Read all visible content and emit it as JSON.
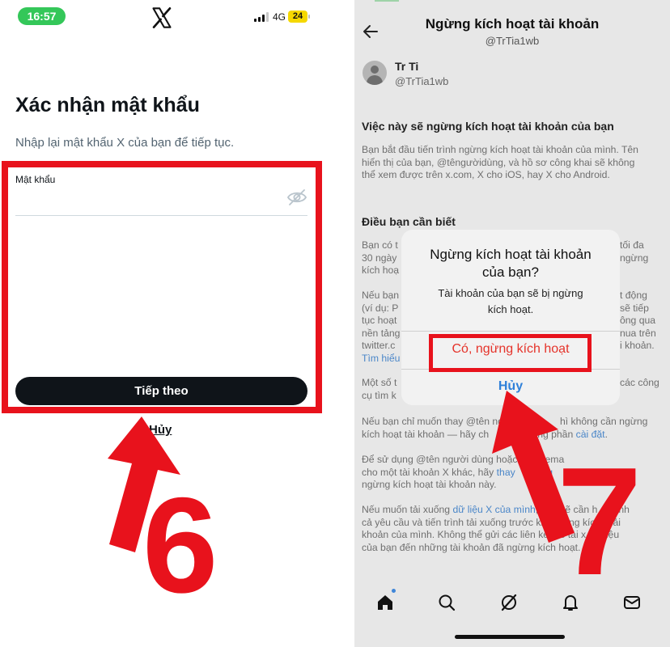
{
  "left": {
    "status": {
      "time": "16:57",
      "network": "4G",
      "battery": "24"
    },
    "title": "Xác nhận mật khẩu",
    "subtitle": "Nhập lại mật khẩu X của bạn để tiếp tục.",
    "password_label": "Mật khẩu",
    "next_button": "Tiếp theo",
    "cancel_link": "Hủy",
    "step_number": "6"
  },
  "right": {
    "title": "Ngừng kích hoạt tài khoản",
    "handle": "@TrTia1wb",
    "user": {
      "name": "Tr Ti",
      "handle": "@TrTia1wb"
    },
    "section1_title": "Việc này sẽ ngừng kích hoạt tài khoản của bạn",
    "section1_lines": [
      "Bạn bắt đầu tiến trình ngừng kích hoạt tài khoản của mình. Tên",
      "hiển thị của bạn, @têngườidùng, và hồ sơ công khai sẽ không",
      "thể xem được trên x.com, X cho iOS, hay X cho Android."
    ],
    "section2_title": "Điều bạn cần biết",
    "section2_p1": [
      "Bạn có t",
      "30 ngày",
      "kích hoạ"
    ],
    "section2_p1_right": [
      "tối đa",
      "ngừng"
    ],
    "section2_p2": [
      "Nếu bạn",
      "(ví dụ: P",
      "tục hoạt",
      "nền tảng",
      "twitter.c"
    ],
    "section2_p2_link": "Tìm hiểu",
    "section2_p2_right": [
      "t động",
      "sẽ tiếp",
      "ông qua",
      "nua trên",
      "i khoản."
    ],
    "section2_p3": [
      "Một số t",
      "cụ tìm k"
    ],
    "section2_p3_right": [
      "các công"
    ],
    "para4_line1": "Nếu bạn chỉ muốn thay @tên ng",
    "para4_line1b": "hì không cần ngừng",
    "para4_line2": "kích hoạt tài khoản — hãy ch",
    "para4_line2b": "ng phần ",
    "para4_link": "cài đặt",
    "para5_line1": "Để sử dụng @tên người dùng hoặc",
    "para5_line1b": "ema",
    "para5_line2": "cho một tài khoản X khác, hãy ",
    "para5_link": "thay",
    "para5_link2": "úng",
    "para5_line3": "ngừng kích hoạt tài khoản này.",
    "para6_line1a": "Nếu muốn tải xuống ",
    "para6_link": "dữ liệu X của mình",
    "para6_line1b": ", bạn sẽ cần h",
    "para6_line1c": "nh",
    "para6_line2": "cả yêu cầu và tiến trình tải xuống trước khi ngừng kíc",
    "para6_line2b": "ải",
    "para6_line3": "khoản của mình. Không thể gửi các liên kết để tải x",
    "para6_line3b": "liệu",
    "para6_line4": "của bạn đến những tài khoản đã ngừng kích hoạt.",
    "dialog": {
      "title_line1": "Ngừng kích hoạt tài khoản",
      "title_line2": "của bạn?",
      "message_line1": "Tài khoản của bạn sẽ bị ngừng",
      "message_line2": "kích hoạt.",
      "confirm": "Có, ngừng kích hoạt",
      "cancel": "Hủy"
    },
    "step_number": "7",
    "nav_icons": [
      "home-icon",
      "search-icon",
      "grok-icon",
      "bell-icon",
      "mail-icon"
    ]
  },
  "colors": {
    "highlight": "#e8121c",
    "status_pill": "#34c759",
    "battery": "#f5d800",
    "link": "#2f80d9",
    "destructive": "#e5332a"
  }
}
